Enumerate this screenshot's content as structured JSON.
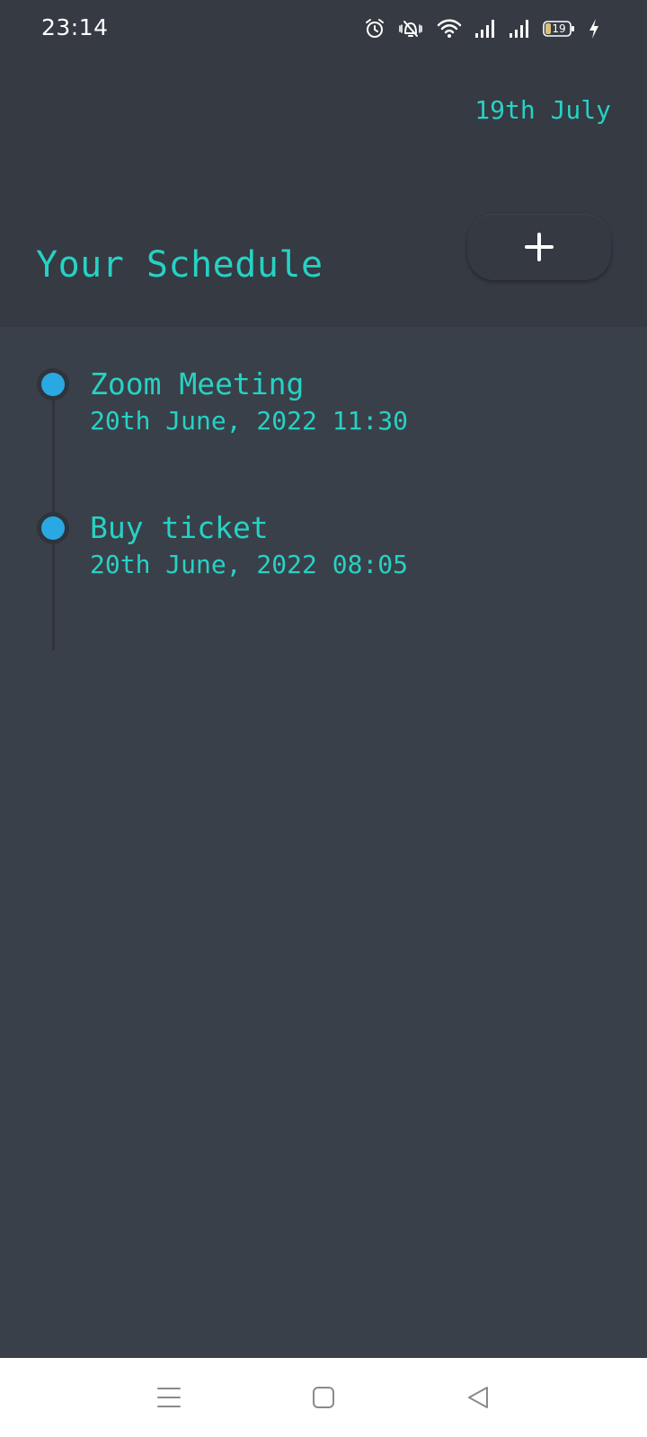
{
  "status_bar": {
    "time": "23:14",
    "battery_level": "19",
    "icons": [
      "alarm-icon",
      "vibrate-silent-icon",
      "wifi-icon",
      "signal-icon",
      "signal-icon",
      "battery-icon",
      "charging-icon"
    ]
  },
  "header": {
    "date": "19th July",
    "title": "Your Schedule",
    "add_icon": "plus-icon"
  },
  "schedule": {
    "items": [
      {
        "title": "Zoom Meeting",
        "datetime": "20th June, 2022 11:30"
      },
      {
        "title": "Buy ticket",
        "datetime": "20th June, 2022 08:05"
      }
    ]
  },
  "nav_bar": {
    "icons": [
      "menu-icon",
      "home-icon",
      "back-icon"
    ]
  },
  "colors": {
    "accent": "#26d2c4",
    "dot": "#2aa8e2",
    "header_bg": "#363a43",
    "body_bg": "#3a404a"
  }
}
